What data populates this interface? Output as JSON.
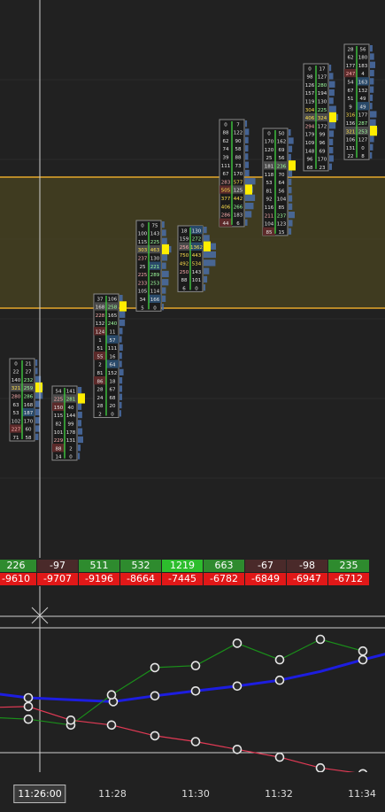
{
  "chart_data": {
    "type": "footprint",
    "colors": {
      "background": "#212121",
      "value_area_band": "#4a4420",
      "value_area_line": "#e6a72b",
      "poc_marker": "#ffee00",
      "delta_positive": "#2e8b2e",
      "delta_strong_positive": "#2dbd2d",
      "delta_negative": "#4a2a2a",
      "cum_delta_negative": "#e01818",
      "blue_series": "#1d1de0",
      "green_series": "#1a8f1a",
      "red_series": "#e23a55"
    },
    "bars": [
      {
        "cells": [
          [
            "0",
            "21"
          ],
          [
            "22",
            "27"
          ],
          [
            "140",
            "232"
          ],
          [
            "321",
            "259"
          ],
          [
            "280",
            "286"
          ],
          [
            "63",
            "168"
          ],
          [
            "53",
            "187"
          ],
          [
            "102",
            "170"
          ],
          [
            "227",
            "60"
          ],
          [
            "71",
            "58"
          ]
        ]
      },
      {
        "cells": [
          [
            "54",
            "141"
          ],
          [
            "225",
            "281"
          ],
          [
            "150",
            "40"
          ],
          [
            "115",
            "144"
          ],
          [
            "82",
            "99"
          ],
          [
            "101",
            "178"
          ],
          [
            "229",
            "131"
          ],
          [
            "88",
            "2"
          ],
          [
            "14",
            "0"
          ]
        ]
      },
      {
        "cells": [
          [
            "37",
            "106"
          ],
          [
            "168",
            "258"
          ],
          [
            "228",
            "165"
          ],
          [
            "132",
            "240"
          ],
          [
            "124",
            "11"
          ],
          [
            "1",
            "57"
          ],
          [
            "51",
            "111"
          ],
          [
            "55",
            "16"
          ],
          [
            "2",
            "64"
          ],
          [
            "81",
            "152"
          ],
          [
            "86",
            "18"
          ],
          [
            "28",
            "67"
          ],
          [
            "24",
            "68"
          ],
          [
            "28",
            "20"
          ],
          [
            "2",
            "0"
          ]
        ]
      },
      {
        "cells": [
          [
            "0",
            "75"
          ],
          [
            "100",
            "143"
          ],
          [
            "115",
            "225"
          ],
          [
            "303",
            "463"
          ],
          [
            "237",
            "130"
          ],
          [
            "25",
            "221"
          ],
          [
            "225",
            "289"
          ],
          [
            "233",
            "253"
          ],
          [
            "105",
            "114"
          ],
          [
            "34",
            "166"
          ],
          [
            "5",
            "0"
          ]
        ]
      },
      {
        "cells": [
          [
            "18",
            "130"
          ],
          [
            "159",
            "272"
          ],
          [
            "256",
            "1362"
          ],
          [
            "750",
            "443"
          ],
          [
            "492",
            "534"
          ],
          [
            "250",
            "143"
          ],
          [
            "88",
            "101"
          ],
          [
            "6",
            "0"
          ]
        ]
      },
      {
        "cells": [
          [
            "0",
            "7"
          ],
          [
            "88",
            "122"
          ],
          [
            "62",
            "90"
          ],
          [
            "74",
            "58"
          ],
          [
            "39",
            "88"
          ],
          [
            "111",
            "73"
          ],
          [
            "67",
            "170"
          ],
          [
            "283",
            "577"
          ],
          [
            "505",
            "125"
          ],
          [
            "377",
            "442"
          ],
          [
            "406",
            "266"
          ],
          [
            "286",
            "183"
          ],
          [
            "44",
            "6"
          ]
        ]
      },
      {
        "cells": [
          [
            "0",
            "50"
          ],
          [
            "170",
            "162"
          ],
          [
            "120",
            "69"
          ],
          [
            "25",
            "56"
          ],
          [
            "181",
            "236"
          ],
          [
            "118",
            "70"
          ],
          [
            "53",
            "64"
          ],
          [
            "81",
            "56"
          ],
          [
            "92",
            "104"
          ],
          [
            "116",
            "85"
          ],
          [
            "211",
            "237"
          ],
          [
            "104",
            "123"
          ],
          [
            "85",
            "15"
          ]
        ]
      },
      {
        "cells": [
          [
            "0",
            "17"
          ],
          [
            "98",
            "127"
          ],
          [
            "126",
            "280"
          ],
          [
            "157",
            "194"
          ],
          [
            "119",
            "130"
          ],
          [
            "304",
            "225"
          ],
          [
            "406",
            "324"
          ],
          [
            "294",
            "172"
          ],
          [
            "179",
            "99"
          ],
          [
            "109",
            "96"
          ],
          [
            "148",
            "69"
          ],
          [
            "96",
            "170"
          ],
          [
            "68",
            "23"
          ]
        ]
      },
      {
        "cells": [
          [
            "28",
            "56"
          ],
          [
            "62",
            "180"
          ],
          [
            "177",
            "183"
          ],
          [
            "247",
            "4"
          ],
          [
            "54",
            "163"
          ],
          [
            "67",
            "132"
          ],
          [
            "51",
            "49"
          ],
          [
            "9",
            "49"
          ],
          [
            "316",
            "177"
          ],
          [
            "136",
            "287"
          ],
          [
            "321",
            "253"
          ],
          [
            "106",
            "127"
          ],
          [
            "131",
            "0"
          ],
          [
            "22",
            "8"
          ]
        ]
      }
    ],
    "delta_row": [
      "226",
      "-97",
      "511",
      "532",
      "1219",
      "663",
      "-67",
      "-98",
      "235"
    ],
    "cum_delta_row": [
      "-9610",
      "-9707",
      "-9196",
      "-8664",
      "-7445",
      "-6782",
      "-6849",
      "-6947",
      "-6712"
    ],
    "x_tick_labels": [
      "11:26:00",
      "11:28",
      "11:30",
      "11:32",
      "11:34"
    ],
    "indicator_series": [
      {
        "color": "#1d1de0",
        "values": [
          0.45,
          0.4,
          0.38,
          0.36,
          0.42,
          0.47,
          0.52,
          0.58,
          0.67,
          0.79,
          0.86,
          0.95
        ]
      },
      {
        "color": "#1a8f1a",
        "values": [
          0.2,
          0.18,
          0.12,
          0.43,
          0.71,
          0.73,
          0.96,
          0.79,
          1.0,
          0.88
        ]
      },
      {
        "color": "#e23a55",
        "values": [
          0.3,
          0.31,
          0.17,
          0.12,
          0.01,
          -0.05,
          -0.13,
          -0.21,
          -0.32,
          -0.38
        ]
      }
    ]
  }
}
